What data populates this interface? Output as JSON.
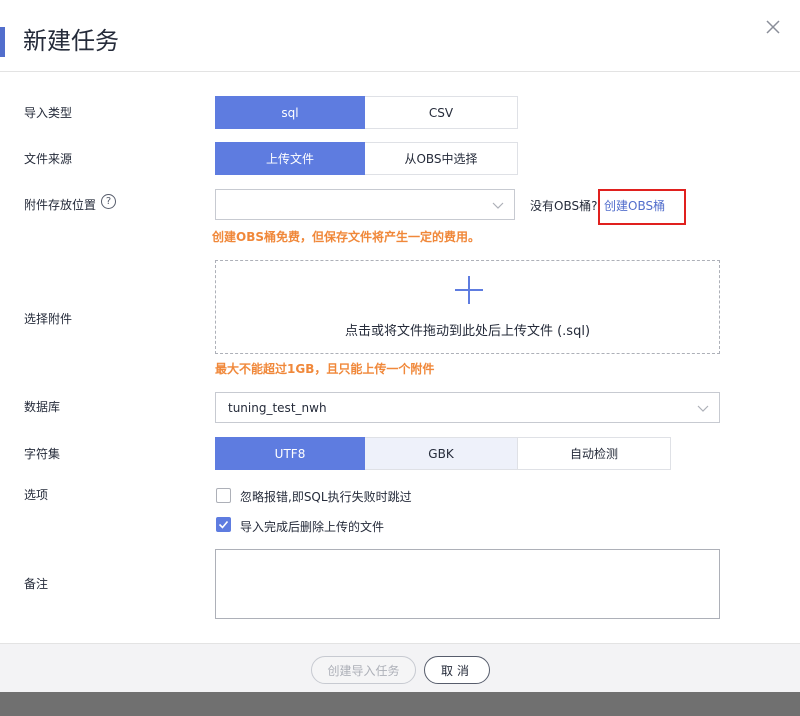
{
  "dialog": {
    "title": "新建任务",
    "accent_color": "#526ecc",
    "close_icon": "close-icon"
  },
  "form": {
    "import_type": {
      "label": "导入类型",
      "options": [
        "sql",
        "CSV"
      ],
      "selected": "sql"
    },
    "file_source": {
      "label": "文件来源",
      "options": [
        "上传文件",
        "从OBS中选择"
      ],
      "selected": "上传文件"
    },
    "attachment_location": {
      "label": "附件存放位置",
      "help_icon": "?",
      "value": "",
      "no_obs_text": "没有OBS桶?",
      "create_obs_link": "创建OBS桶",
      "warning": "创建OBS桶免费，但保存文件将产生一定的费用。"
    },
    "select_attachment": {
      "label": "选择附件",
      "upload_text": "点击或将文件拖动到此处后上传文件 (.sql)",
      "warning": "最大不能超过1GB，且只能上传一个附件"
    },
    "database": {
      "label": "数据库",
      "value": "tuning_test_nwh"
    },
    "charset": {
      "label": "字符集",
      "options": [
        "UTF8",
        "GBK",
        "自动检测"
      ],
      "selected": "UTF8"
    },
    "options": {
      "label": "选项",
      "items": [
        {
          "text": "忽略报错,即SQL执行失败时跳过",
          "checked": false
        },
        {
          "text": "导入完成后删除上传的文件",
          "checked": true
        }
      ]
    },
    "remarks": {
      "label": "备注",
      "value": ""
    }
  },
  "footer": {
    "submit_label": "创建导入任务",
    "cancel_label": "取消"
  },
  "colors": {
    "primary": "#5e7ce0",
    "warning": "#f0883a",
    "highlight_border": "#e0201e",
    "link": "#526ecc"
  }
}
